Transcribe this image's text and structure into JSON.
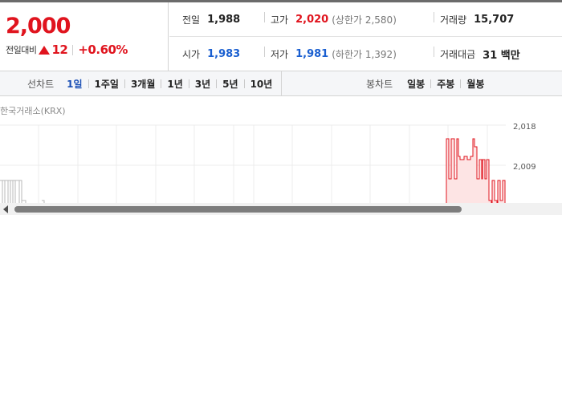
{
  "quote": {
    "price": "2,000",
    "change_label": "전일대비",
    "change_icon": "up-triangle-icon",
    "change": "12",
    "change_rate": "+0.60%",
    "stats": {
      "prev_close": {
        "label": "전일",
        "value": "1,988"
      },
      "high": {
        "label": "고가",
        "value": "2,020",
        "sub": "(상한가 2,580)"
      },
      "volume": {
        "label": "거래량",
        "value": "15,707"
      },
      "open": {
        "label": "시가",
        "value": "1,983"
      },
      "low": {
        "label": "저가",
        "value": "1,981",
        "sub": "(하한가 1,392)"
      },
      "amount": {
        "label": "거래대금",
        "value": "31 백만"
      }
    }
  },
  "tabs": {
    "line_title": "선차트",
    "line_tabs": [
      "1일",
      "1주일",
      "3개월",
      "1년",
      "3년",
      "5년",
      "10년"
    ],
    "active_index": 0,
    "candle_title": "봉차트",
    "candle_tabs": [
      "일봉",
      "주봉",
      "월봉"
    ]
  },
  "chart": {
    "exchange": "한국거래소(KRX)",
    "y_ticks": [
      "2,018",
      "2,009"
    ],
    "colors": {
      "up": "#e0141e",
      "up_fill": "#fde4e4",
      "neutral": "#b8b8b8",
      "grid": "#ececec"
    }
  }
}
